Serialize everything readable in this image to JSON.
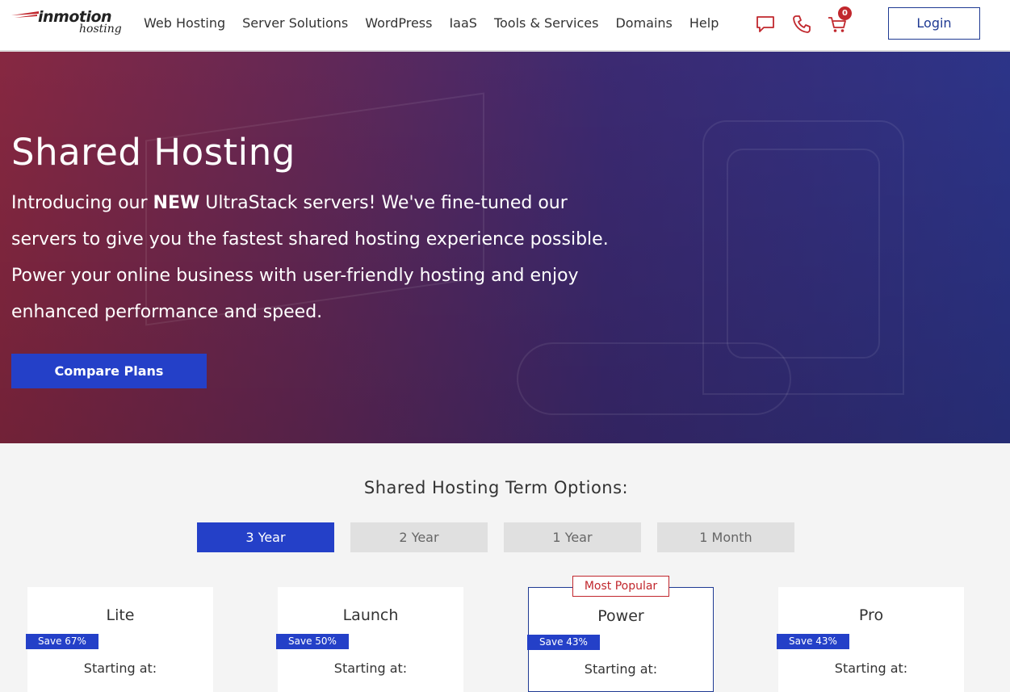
{
  "logo": {
    "brand": "inmotion",
    "sub": "hosting"
  },
  "nav": {
    "links": [
      "Web Hosting",
      "Server Solutions",
      "WordPress",
      "IaaS",
      "Tools & Services",
      "Domains",
      "Help"
    ],
    "cart_count": "0",
    "login_label": "Login"
  },
  "hero": {
    "title": "Shared Hosting",
    "text_prefix": "Introducing our ",
    "text_bold": "NEW",
    "text_rest": " UltraStack servers! We've fine-tuned our servers to give you the fastest shared hosting experience possible. Power your online business with user-friendly hosting and enjoy enhanced performance and speed.",
    "button_label": "Compare Plans"
  },
  "terms": {
    "title": "Shared Hosting Term Options:",
    "tabs": [
      "3 Year",
      "2 Year",
      "1 Year",
      "1 Month"
    ],
    "active": "3 Year"
  },
  "plans": [
    {
      "name": "Lite",
      "save": "Save 67%",
      "starting": "Starting at:"
    },
    {
      "name": "Launch",
      "save": "Save 50%",
      "starting": "Starting at:"
    },
    {
      "name": "Power",
      "save": "Save 43%",
      "starting": "Starting at:",
      "tag": "Most Popular"
    },
    {
      "name": "Pro",
      "save": "Save 43%",
      "starting": "Starting at:"
    }
  ],
  "colors": {
    "accent": "#2440c8",
    "brand_red": "#c1272d",
    "navy": "#1f3a93"
  }
}
